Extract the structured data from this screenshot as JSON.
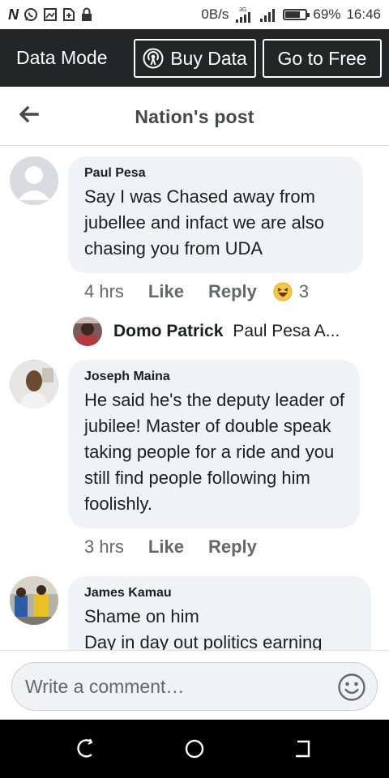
{
  "status_bar": {
    "left_icons": [
      "n-app-icon",
      "whatsapp-icon",
      "gallery-icon",
      "sim-icon",
      "lock-icon"
    ],
    "net_speed": "0B/s",
    "network_type": "3G",
    "battery": "69%",
    "battery_level": 0.69,
    "time": "16:46"
  },
  "data_bar": {
    "mode_label": "Data Mode",
    "buy_data_label": "Buy Data",
    "go_free_label": "Go to Free"
  },
  "header": {
    "title": "Nation's post",
    "back_icon": "arrow-left-icon"
  },
  "comments": [
    {
      "author": "Paul Pesa",
      "text": "Say I was Chased away from jubellee and infact we are also chasing you from UDA",
      "time": "4 hrs",
      "like_label": "Like",
      "reply_label": "Reply",
      "reaction_icon": "haha-emoji-icon",
      "reaction_count": "3",
      "reply_preview": {
        "author": "Domo Patrick",
        "text": "Paul Pesa A..."
      }
    },
    {
      "author": "Joseph Maina",
      "text": "He said he's the deputy leader of  jubilee! Master of double speak taking people for a ride and you still find people following him foolishly.",
      "time": "3 hrs",
      "like_label": "Like",
      "reply_label": "Reply"
    },
    {
      "author": "James Kamau",
      "text": "Shame on him\nDay in day out politics earning"
    }
  ],
  "composer": {
    "placeholder": "Write a comment…",
    "value": "",
    "emoji_icon": "smiley-icon"
  },
  "nav_bar": {
    "icons": [
      "back-nav-icon",
      "home-nav-icon",
      "recents-nav-icon"
    ]
  }
}
